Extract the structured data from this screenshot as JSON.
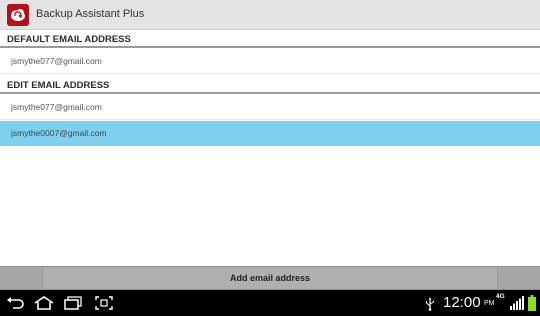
{
  "app": {
    "title": "Backup Assistant Plus"
  },
  "sections": {
    "default_header": "DEFAULT EMAIL ADDRESS",
    "default_email": "jsmythe077@gmail.com",
    "edit_header": "EDIT EMAIL ADDRESS",
    "edit_emails": [
      "jsmythe077@gmail.com",
      "jsmythe0007@gmail.com"
    ],
    "selected_index": 1
  },
  "actions": {
    "add_label": "Add email address"
  },
  "statusbar": {
    "time": "12:00",
    "ampm": "PM",
    "network": "4G",
    "icons": [
      "usb-icon",
      "signal-icon",
      "battery-icon"
    ]
  },
  "navbar": {
    "icons": [
      "back-icon",
      "home-icon",
      "recent-apps-icon",
      "screenshot-icon"
    ]
  },
  "colors": {
    "selection": "#7fd0ef",
    "app_icon": "#b3121c",
    "battery": "#8fdc2a"
  }
}
